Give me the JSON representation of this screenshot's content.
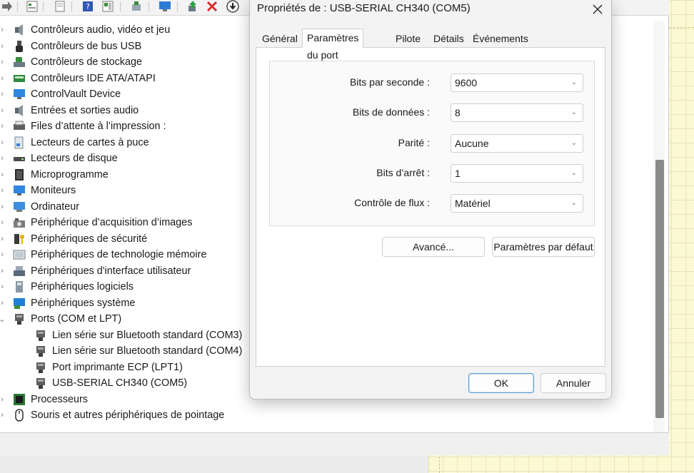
{
  "devmgr": {
    "tree": [
      {
        "label": "Contrôleurs audio, vidéo et jeu",
        "expand": "›",
        "icon": "speaker-icon",
        "child": false
      },
      {
        "label": "Contrôleurs de bus USB",
        "expand": "›",
        "icon": "usb-icon",
        "child": false
      },
      {
        "label": "Contrôleurs de stockage",
        "expand": "›",
        "icon": "storage-controller-icon",
        "child": false
      },
      {
        "label": "Contrôleurs IDE ATA/ATAPI",
        "expand": "›",
        "icon": "ide-controller-icon",
        "child": false
      },
      {
        "label": "ControlVault Device",
        "expand": "›",
        "icon": "monitor-icon",
        "child": false
      },
      {
        "label": "Entrées et sorties audio",
        "expand": "›",
        "icon": "speaker-icon",
        "child": false
      },
      {
        "label": "Files d’attente à l’impression :",
        "expand": "›",
        "icon": "printer-icon",
        "child": false
      },
      {
        "label": "Lecteurs de cartes à puce",
        "expand": "›",
        "icon": "smartcard-icon",
        "child": false
      },
      {
        "label": "Lecteurs de disque",
        "expand": "›",
        "icon": "disk-drive-icon",
        "child": false
      },
      {
        "label": "Microprogramme",
        "expand": "›",
        "icon": "chip-icon",
        "child": false
      },
      {
        "label": "Moniteurs",
        "expand": "›",
        "icon": "monitor-icon",
        "child": false
      },
      {
        "label": "Ordinateur",
        "expand": "›",
        "icon": "computer-icon",
        "child": false
      },
      {
        "label": "Périphérique d’acquisition d’images",
        "expand": "›",
        "icon": "camera-icon",
        "child": false
      },
      {
        "label": "Périphériques de sécurité",
        "expand": "›",
        "icon": "security-key-icon",
        "child": false
      },
      {
        "label": "Périphériques de technologie mémoire",
        "expand": "›",
        "icon": "memory-icon",
        "child": false
      },
      {
        "label": "Périphériques d'interface utilisateur",
        "expand": "›",
        "icon": "hid-icon",
        "child": false
      },
      {
        "label": "Périphériques logiciels",
        "expand": "›",
        "icon": "software-device-icon",
        "child": false
      },
      {
        "label": "Périphériques système",
        "expand": "›",
        "icon": "system-device-icon",
        "child": false
      },
      {
        "label": "Ports (COM et LPT)",
        "expand": "⌄",
        "icon": "port-icon",
        "child": false
      },
      {
        "label": "Lien série sur Bluetooth standard (COM3)",
        "expand": "",
        "icon": "port-icon",
        "child": true
      },
      {
        "label": "Lien série sur Bluetooth standard (COM4)",
        "expand": "",
        "icon": "port-icon",
        "child": true
      },
      {
        "label": "Port imprimante ECP (LPT1)",
        "expand": "",
        "icon": "port-icon",
        "child": true
      },
      {
        "label": "USB-SERIAL CH340 (COM5)",
        "expand": "",
        "icon": "port-icon",
        "child": true
      },
      {
        "label": "Processeurs",
        "expand": "›",
        "icon": "processor-icon",
        "child": false
      },
      {
        "label": "Souris et autres périphériques de pointage",
        "expand": "›",
        "icon": "mouse-icon",
        "child": false
      }
    ]
  },
  "dialog": {
    "title": "Propriétés de : USB-SERIAL CH340 (COM5)",
    "tabs": [
      "Général",
      "Paramètres du port",
      "Pilote",
      "Détails",
      "Événements"
    ],
    "active_tab": "Paramètres du port",
    "fields": [
      {
        "label": "Bits par seconde :",
        "value": "9600"
      },
      {
        "label": "Bits de données :",
        "value": "8"
      },
      {
        "label": "Parité :",
        "value": "Aucune"
      },
      {
        "label": "Bits d’arrêt :",
        "value": "1"
      },
      {
        "label": "Contrôle de flux :",
        "value": "Matériel"
      }
    ],
    "advanced_button": "Avancé...",
    "defaults_button": "Paramètres par défaut",
    "ok_button": "OK",
    "cancel_button": "Annuler"
  },
  "colors": {
    "accent": "#5b9bd5",
    "grid_background": "#fbf8d4"
  }
}
